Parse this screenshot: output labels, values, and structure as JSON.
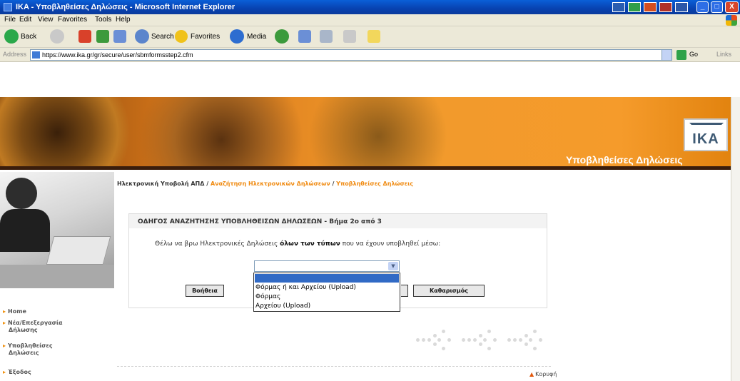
{
  "window": {
    "title": "IKA - Υποβληθείσες Δηλώσεις - Microsoft Internet Explorer",
    "controls": {
      "minimize": "_",
      "maximize": "□",
      "close": "X"
    }
  },
  "menu": [
    "File",
    "Edit",
    "View",
    "Favorites",
    "Tools",
    "Help"
  ],
  "toolbar": {
    "back": "Back",
    "search": "Search",
    "favorites": "Favorites",
    "media": "Media"
  },
  "address": {
    "label": "Address",
    "url": "https://www.ika.gr/gr/secure/user/sbmformsstep2.cfm",
    "go": "Go",
    "links": "Links"
  },
  "banner": {
    "logo_text": "IKA",
    "title": "Υποβληθείσες Δηλώσεις"
  },
  "sidebar": {
    "items": [
      "Home",
      "Νέα/Επεξεργασία Δήλωσης",
      "Υποβληθείσες Δηλώσεις",
      "Έξοδος"
    ]
  },
  "breadcrumb": {
    "root": "Ηλεκτρονική Υποβολή ΑΠΔ",
    "sep": "/",
    "mid": "Αναζήτηση Ηλεκτρονικών Δηλώσεων",
    "current": "Υποβληθείσες Δηλώσεις"
  },
  "wizard": {
    "title": "ΟΔΗΓΟΣ ΑΝΑΖΗΤΗΣΗΣ ΥΠΟΒΛΗΘΕΙΣΩΝ ΔΗΛΩΣΕΩΝ - Βήμα 2ο από 3",
    "text_before": "Θέλω να βρω Ηλεκτρονικές Δηλώσεις ",
    "text_bold": "όλων των τύπων",
    "text_after": " που να έχουν υποβληθεί μέσω:",
    "select_value": "",
    "options": [
      "",
      "Φόρμας ή και Αρχείου (Upload)",
      "Φόρμας",
      "Αρχείου (Upload)"
    ],
    "help_button": "Βοήθεια",
    "clear_button": "Καθαρισμός"
  },
  "footer": {
    "top_link": "Κορυφή"
  },
  "colors": {
    "accent": "#f08a10",
    "title_bar": "#0a4fc4",
    "selection": "#316ac5"
  }
}
